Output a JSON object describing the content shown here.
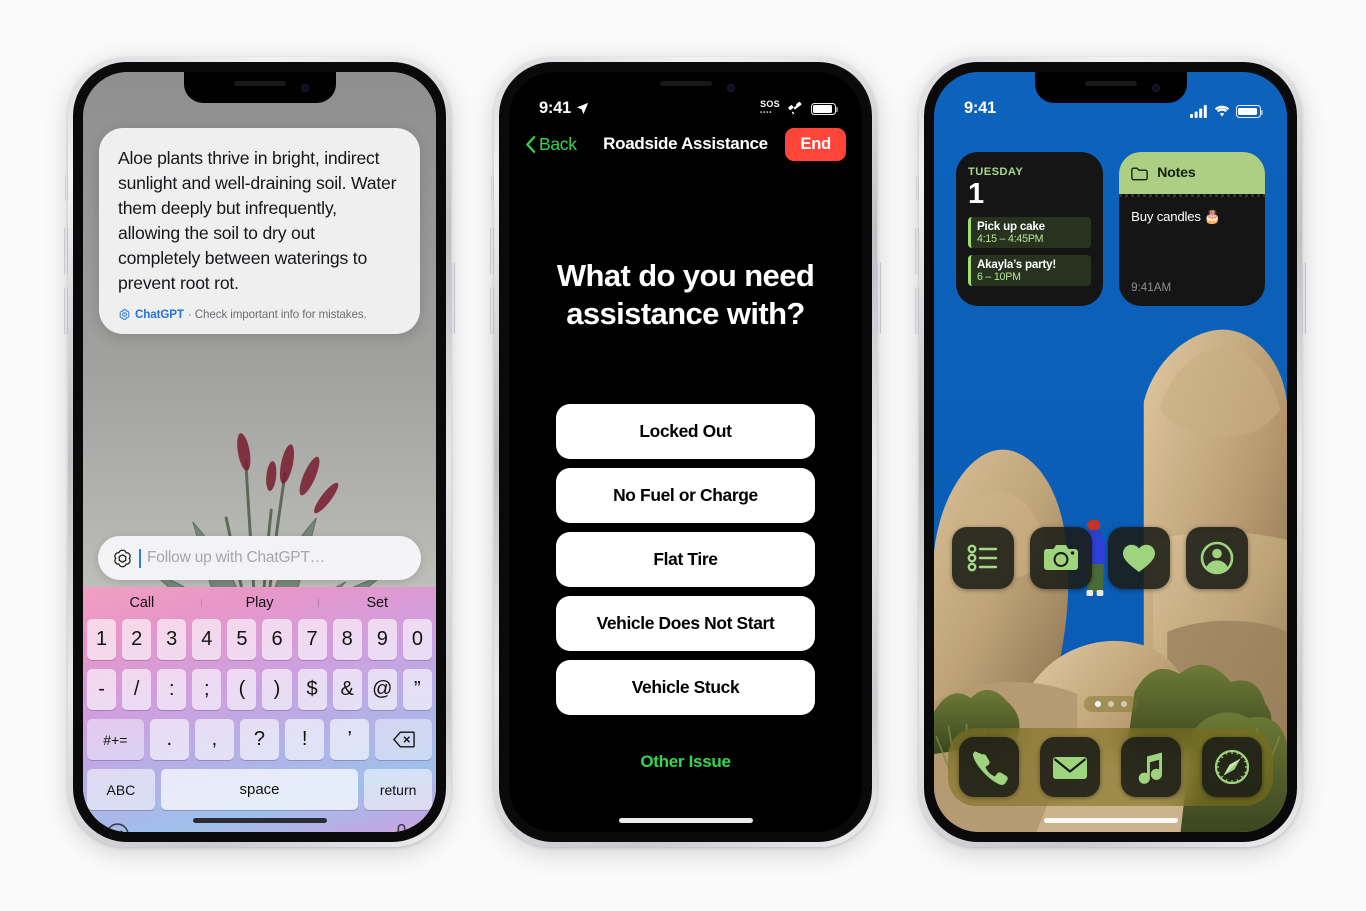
{
  "page": {
    "background": "#fafafa"
  },
  "phone1": {
    "name": "iphone-chatgpt-keyboard",
    "chat": {
      "message": "Aloe plants thrive in bright, indirect sunlight and well-draining soil. Water them deeply but infrequently, allowing the soil to dry out completely between waterings to prevent root rot.",
      "brand": "ChatGPT",
      "disclaimer": "· Check important info for mistakes.",
      "brand_color": "#2573d6"
    },
    "input": {
      "placeholder": "Follow up with ChatGPT…",
      "value": ""
    },
    "keyboard": {
      "suggestions": [
        "Call",
        "Play",
        "Set"
      ],
      "row1": [
        "1",
        "2",
        "3",
        "4",
        "5",
        "6",
        "7",
        "8",
        "9",
        "0"
      ],
      "row2": [
        "-",
        "/",
        ":",
        ";",
        "(",
        ")",
        "$",
        "&",
        "@",
        "”"
      ],
      "row3": [
        "#+=",
        ".",
        ",",
        "?",
        "!",
        "’"
      ],
      "abc": "ABC",
      "space": "space",
      "return": "return"
    }
  },
  "phone2": {
    "name": "iphone-roadside-assistance",
    "statusbar": {
      "time": "9:41",
      "sos": "SOS"
    },
    "nav": {
      "back": "Back",
      "title": "Roadside Assistance",
      "end": "End",
      "accent": "#32d74b",
      "end_color": "#ff453a"
    },
    "heading": "What do you need assistance with?",
    "options": [
      "Locked Out",
      "No Fuel or Charge",
      "Flat Tire",
      "Vehicle Does Not Start",
      "Vehicle Stuck"
    ],
    "other": "Other Issue"
  },
  "phone3": {
    "name": "iphone-home-screen",
    "statusbar": {
      "time": "9:41"
    },
    "calendar_widget": {
      "day_of_week": "TUESDAY",
      "day_number": "1",
      "events": [
        {
          "title": "Pick up cake",
          "time": "4:15 – 4:45PM"
        },
        {
          "title": "Akayla’s party!",
          "time": "6 – 10PM"
        }
      ]
    },
    "notes_widget": {
      "title": "Notes",
      "note": "Buy candles 🎂",
      "time": "9:41AM"
    },
    "apps": [
      {
        "label": "Reminders",
        "icon": "reminders-icon"
      },
      {
        "label": "Camera",
        "icon": "camera-icon"
      },
      {
        "label": "Health",
        "icon": "heart-icon"
      },
      {
        "label": "Contacts",
        "icon": "contacts-icon"
      }
    ],
    "page_dots": {
      "count": 3,
      "active": 0
    },
    "dock": [
      {
        "label": "Phone",
        "icon": "phone-icon"
      },
      {
        "label": "Mail",
        "icon": "mail-icon"
      },
      {
        "label": "Music",
        "icon": "music-icon"
      },
      {
        "label": "Safari",
        "icon": "compass-icon"
      }
    ]
  }
}
